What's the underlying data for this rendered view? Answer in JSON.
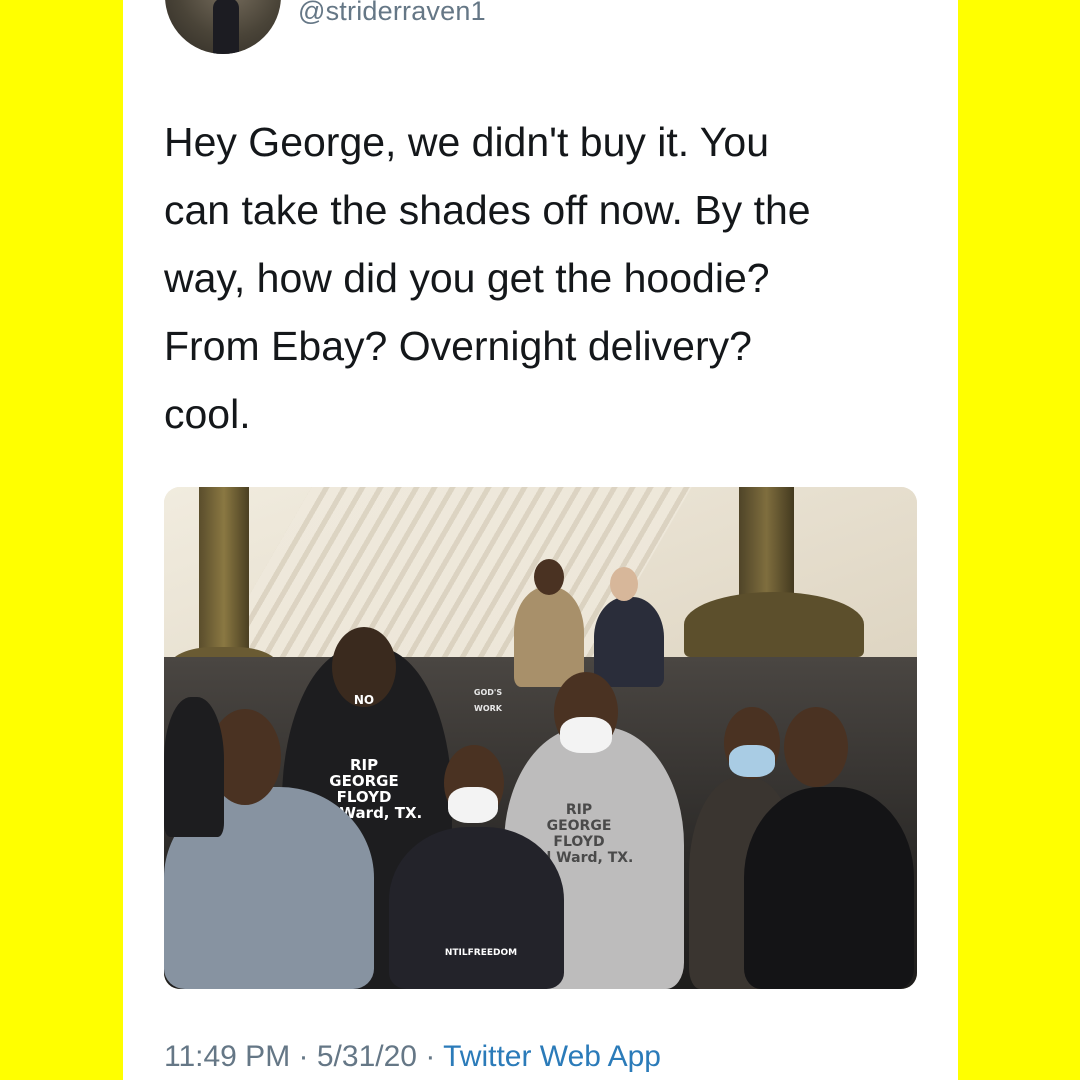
{
  "tweet": {
    "handle": "@striderraven1",
    "text": "Hey George, we didn't buy it. You\ncan take the shades off now. By the\nway, how did you get the hoodie?\nFrom Ebay? Overnight delivery?\ncool.",
    "photo_prints": {
      "hoodie_left": "RIP\nGEORGE FLOYD\n3rd Ward, TX.",
      "hoodie_center": "RIP\nGEORGE FLOYD\n3rd Ward, TX.",
      "shirt_center": "NTILFREEDOM",
      "mask_left": "NO",
      "cap_center": "GOD'S WORK"
    },
    "time": "11:49 PM",
    "separator": "·",
    "date": "5/31/20",
    "source": "Twitter Web App"
  },
  "colors": {
    "background": "#ffff00",
    "card": "#ffffff",
    "text": "#14171a",
    "muted": "#657786",
    "link": "#2b7bb9"
  },
  "icons": [
    "avatar-photo"
  ]
}
